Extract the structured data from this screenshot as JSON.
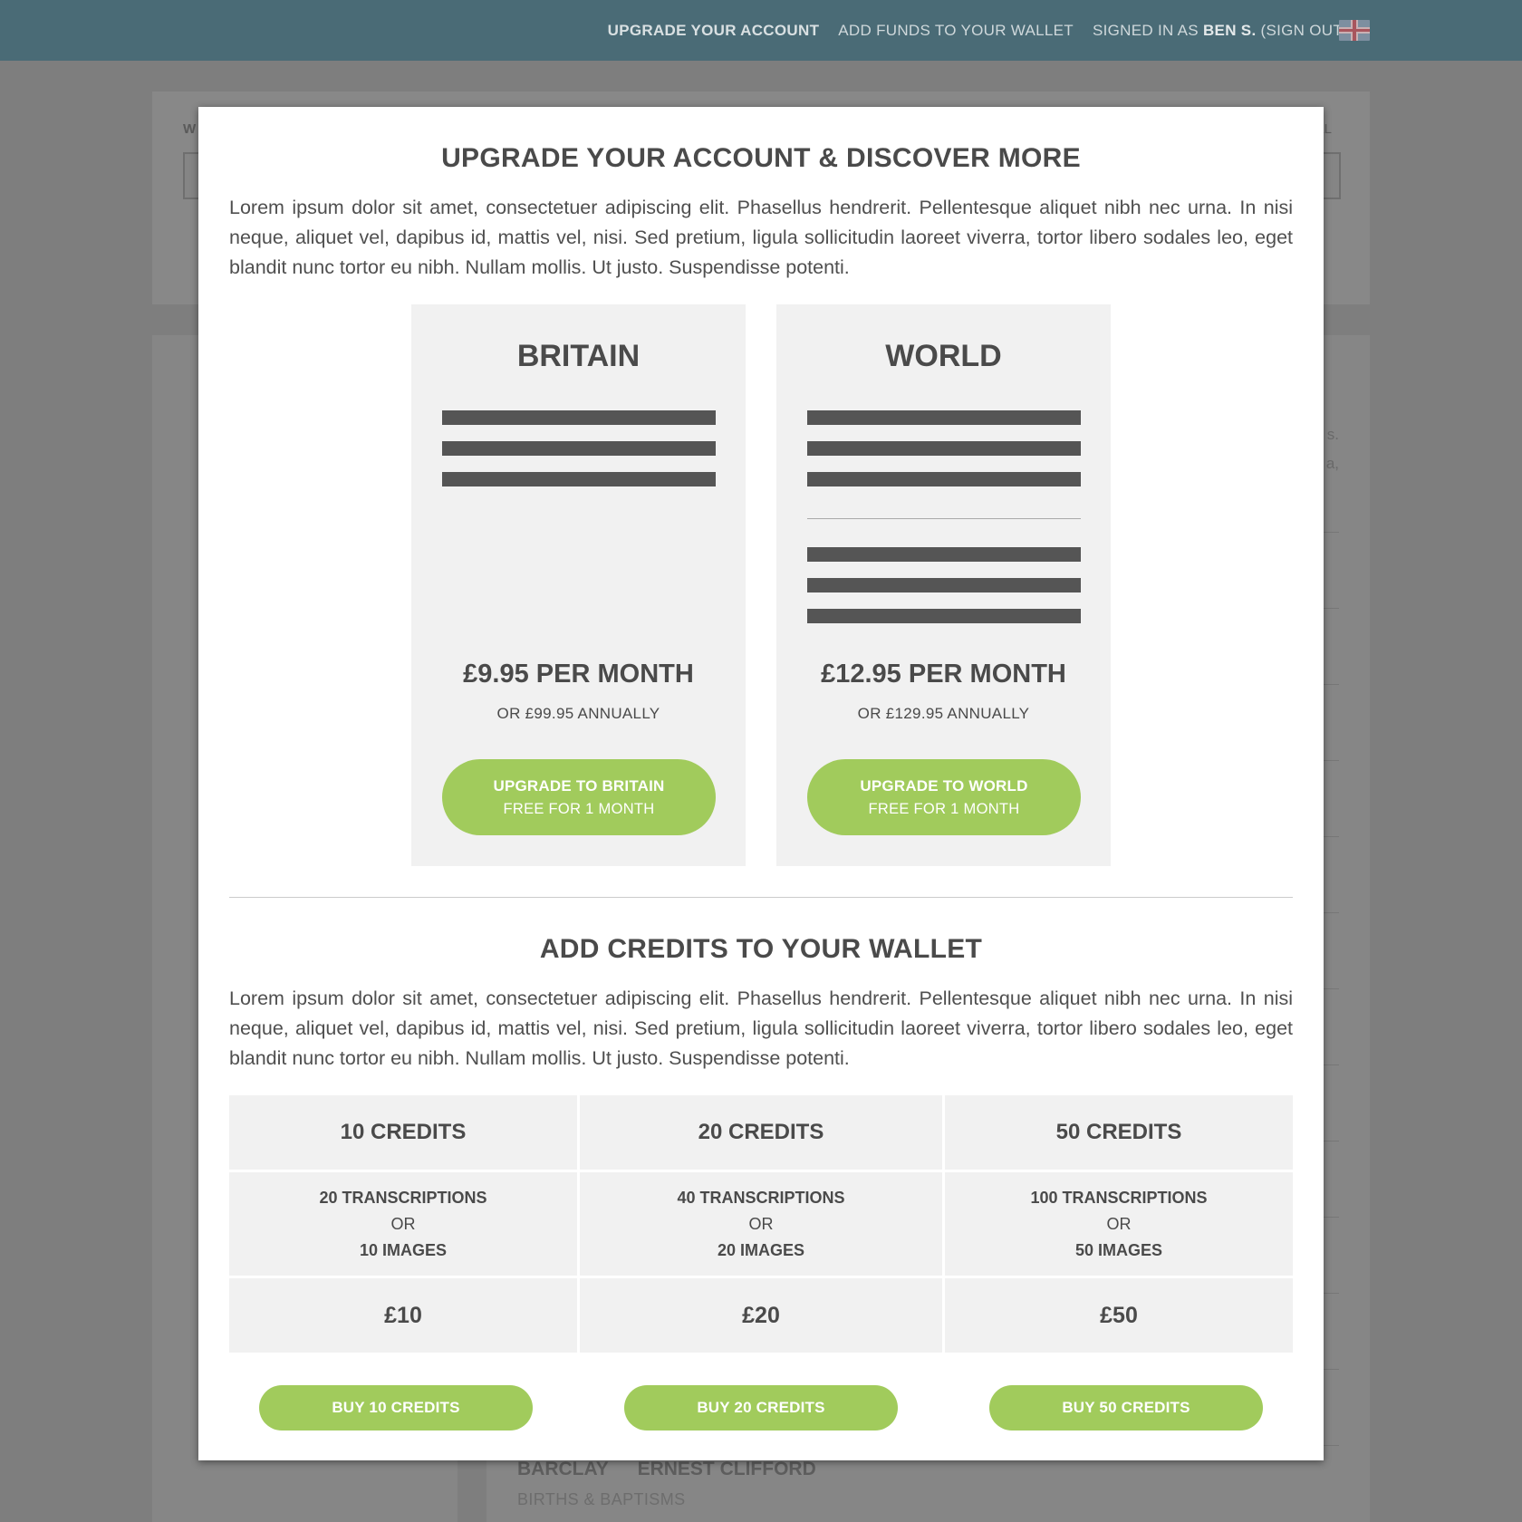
{
  "topbar": {
    "upgrade_link": "UPGRADE YOUR ACCOUNT",
    "add_funds_link": "ADD FUNDS TO YOUR WALLET",
    "signed_in_prefix": "SIGNED IN AS",
    "user_name": "BEN S.",
    "sign_out": "(SIGN OUT)",
    "flag_icon": "uk-flag-icon"
  },
  "background": {
    "search_label_fragment": "W",
    "search_right_fragment": "AL",
    "side_text_1": "s.",
    "side_text_2": "a,",
    "record": {
      "surname": "BARCLAY",
      "forenames": "ERNEST CLIFFORD",
      "type": "BIRTHS & BAPTISMS"
    }
  },
  "modal": {
    "upgrade": {
      "title": "UPGRADE YOUR ACCOUNT & DISCOVER MORE",
      "body": "Lorem ipsum dolor sit amet, consectetuer adipiscing elit. Phasellus hendrerit. Pellentesque aliquet nibh nec urna. In nisi neque, aliquet vel, dapibus id, mattis vel, nisi. Sed pretium, ligula sollicitudin laoreet viverra, tortor libero sodales leo, eget blandit nunc tortor eu nibh. Nullam mollis. Ut justo. Suspendisse potenti.",
      "plans": [
        {
          "name": "BRITAIN",
          "price": "£9.95 PER MONTH",
          "annual": "OR £99.95 ANNUALLY",
          "cta_line1": "UPGRADE TO BRITAIN",
          "cta_line2": "FREE FOR 1 MONTH"
        },
        {
          "name": "WORLD",
          "price": "£12.95 PER MONTH",
          "annual": "OR £129.95 ANNUALLY",
          "cta_line1": "UPGRADE TO WORLD",
          "cta_line2": "FREE FOR 1 MONTH"
        }
      ]
    },
    "wallet": {
      "title": "ADD CREDITS TO YOUR WALLET",
      "body": "Lorem ipsum dolor sit amet, consectetuer adipiscing elit. Phasellus hendrerit. Pellentesque aliquet nibh nec urna. In nisi neque, aliquet vel, dapibus id, mattis vel, nisi. Sed pretium, ligula sollicitudin laoreet viverra, tortor libero sodales leo, eget blandit nunc tortor eu nibh. Nullam mollis. Ut justo. Suspendisse potenti.",
      "packages": [
        {
          "credits": "10 CREDITS",
          "transcriptions": "20 TRANSCRIPTIONS",
          "or": "OR",
          "images": "10 IMAGES",
          "price": "£10",
          "buy": "BUY 10 CREDITS"
        },
        {
          "credits": "20 CREDITS",
          "transcriptions": "40 TRANSCRIPTIONS",
          "or": "OR",
          "images": "20 IMAGES",
          "price": "£20",
          "buy": "BUY 20 CREDITS"
        },
        {
          "credits": "50 CREDITS",
          "transcriptions": "100 TRANSCRIPTIONS",
          "or": "OR",
          "images": "50 IMAGES",
          "price": "£50",
          "buy": "BUY 50 CREDITS"
        }
      ]
    }
  },
  "colors": {
    "topbar": "#4a6b76",
    "accent_green": "#a1cb5c",
    "card_bg": "#f1f1f1",
    "text_dark": "#4a4a4a"
  }
}
